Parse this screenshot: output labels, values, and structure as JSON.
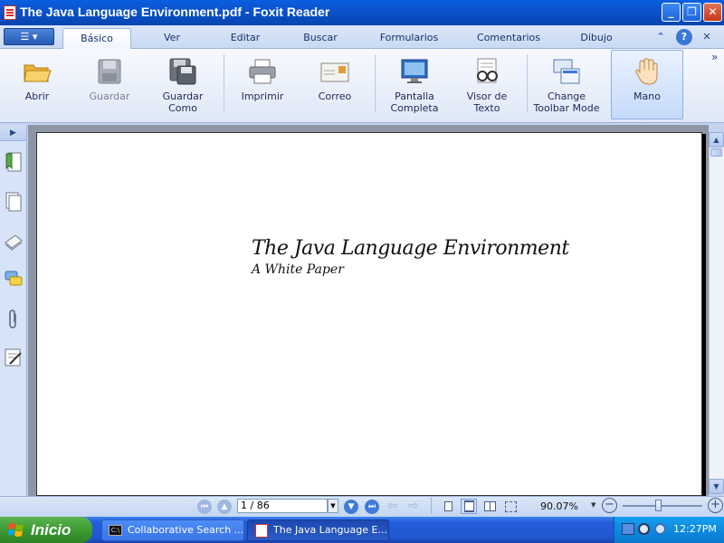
{
  "window": {
    "title": "The Java Language Environment.pdf - Foxit Reader",
    "buttons": {
      "minimize": "_",
      "maximize": "❐",
      "close": "✕"
    }
  },
  "ribbon": {
    "menu_icon": "app-menu-icon",
    "tabs": [
      {
        "label": "Básico",
        "active": true
      },
      {
        "label": "Ver"
      },
      {
        "label": "Editar"
      },
      {
        "label": "Buscar"
      },
      {
        "label": "Formularios"
      },
      {
        "label": "Comentarios"
      },
      {
        "label": "Dibujo"
      }
    ],
    "collapse_glyph": "⌃",
    "help_glyph": "?",
    "close_glyph": "✕",
    "overflow_glyph": "»",
    "buttons": [
      {
        "label": "Abrir",
        "icon": "folder-open-icon"
      },
      {
        "label": "Guardar",
        "icon": "save-icon",
        "disabled": true
      },
      {
        "label": "Guardar\nComo",
        "line1": "Guardar",
        "line2": "Como",
        "icon": "save-as-icon"
      },
      {
        "label": "Imprimir",
        "icon": "printer-icon"
      },
      {
        "label": "Correo",
        "icon": "mail-icon"
      },
      {
        "line1": "Pantalla",
        "line2": "Completa",
        "icon": "fullscreen-icon"
      },
      {
        "line1": "Visor de",
        "line2": "Texto",
        "icon": "text-viewer-icon"
      },
      {
        "line1": "Change",
        "line2": "Toolbar Mode",
        "icon": "toolbar-mode-icon"
      },
      {
        "label": "Mano",
        "icon": "hand-icon",
        "active": true
      }
    ]
  },
  "sidebar": {
    "expand_glyph": "▶",
    "panels": [
      "bookmarks-icon",
      "pages-icon",
      "layers-icon",
      "comments-icon",
      "attachments-icon",
      "signature-icon"
    ]
  },
  "document": {
    "title": "The Java Language Environment",
    "subtitle": "A White Paper"
  },
  "statusbar": {
    "page_value": "1 / 86",
    "zoom": "90.07%",
    "zoom_minus": "−",
    "zoom_plus": "+",
    "dropdown_glyph": "▼"
  },
  "taskbar": {
    "start_label": "Inicio",
    "items": [
      {
        "label": "Collaborative Search ...",
        "icon": "cmd-icon",
        "active": false
      },
      {
        "label": "The Java Language E...",
        "icon": "foxit-icon",
        "active": true
      }
    ],
    "clock": "12:27PM"
  },
  "colors": {
    "titlebar": "#0b53cc",
    "ribbon": "#dfe8f7",
    "taskbar": "#245edb",
    "start": "#3c9a33"
  }
}
